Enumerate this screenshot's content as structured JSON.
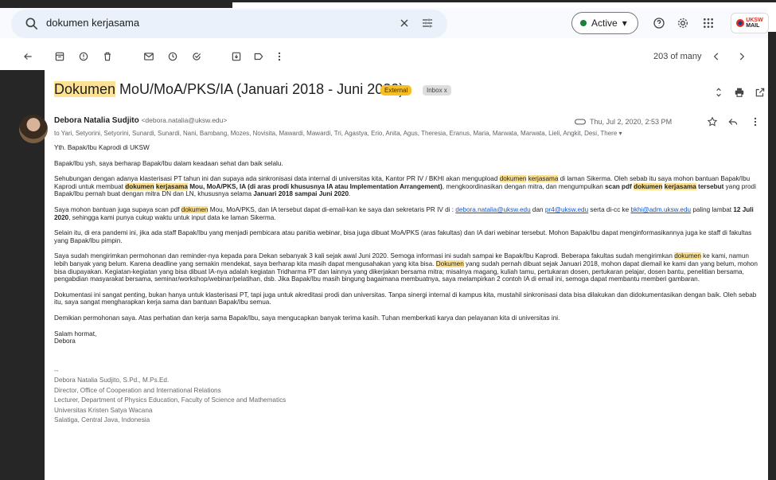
{
  "search": {
    "query": "dokumen kerjasama"
  },
  "status": {
    "label": "Active"
  },
  "logo": {
    "line1": "UKSW",
    "line2": "MAIL"
  },
  "toolbar": {
    "count": "203 of many"
  },
  "subject": {
    "highlight": "Dokumen",
    "rest": " MoU/MoA/PKS/IA (Januari 2018 - Juni 2020)",
    "tag_external": "External",
    "tag_inbox": "Inbox x"
  },
  "sender": {
    "name": "Debora Natalia Sudjito",
    "email": "<debora.natalia@uksw.edu>",
    "date": "Thu, Jul 2, 2020, 2:53 PM",
    "to": "to Yari, Setyorini, Setyorini, Sunardi, Sunardi, Nani, Bambang, Mozes, Novisita, Mawardi, Mawardi, Tri, Agastya, Erio, Anita, Agus, Theresia, Eranus, Maria, Marwata, Marwata, Lieli, Angkit, Desi, There ▾"
  },
  "body": {
    "greeting": "Yth. Bapak/Ibu Kaprodi di UKSW",
    "p1": "Bapak/Ibu ysh, saya berharap Bapak/Ibu dalam keadaan sehat dan baik selalu.",
    "p2": {
      "a": "Sehubungan dengan adanya klasterisasi PT tahun ini dan supaya ada sinkronisasi data internal di universitas kita, Kantor PR IV / BKHI akan mengupload ",
      "h1": "dokumen",
      "s1": " ",
      "h2": "kerjasama",
      "b": " di laman Sikerma. Oleh sebab itu saya mohon bantuan Bapak/Ibu Kaprodi untuk membuat ",
      "h3": "dokumen",
      "s2": " ",
      "h4": "kerjasama",
      "bold1": " Mou, MoA/PKS, IA (di aras prodi khususnya IA atau Implementation Arrangement)",
      "c": ", mengkoordinasikan dengan mitra, dan mengumpulkan ",
      "bold2": "scan pdf ",
      "h5": "dokumen",
      "s3": " ",
      "h6": "kerjasama",
      "bold3": " tersebut",
      "d": " yang prodi Bapak/Ibu pernah buat dengan mitra DN dan LN, khususnya selama ",
      "bold4": "Januari 2018 sampai Juni 2020",
      "e": "."
    },
    "p3": {
      "a": "Saya mohon bantuan juga supaya scan pdf ",
      "h1": "dokumen",
      "b": " Mou, MoA/PKS, dan IA  tersebut dapat di-email-kan ke saya dan sekretaris PR IV di : ",
      "link1": "debora.natalia@uksw.edu",
      "c": " dan ",
      "link2": "pr4@uksw.edu",
      "d": " serta di-cc ke ",
      "link3": "bkhi@adm.uksw.edu",
      "e": " paling lambat ",
      "bold1": "12 Juli 2020",
      "f": ", sehingga kami punya cukup waktu untuk input data ke laman Sikerma."
    },
    "p4": "Selain itu, di era pandemi ini, jika ada staff Bapak/Ibu yang menjadi pembicara atau panitia webinar, bisa juga dibuat MoA/PKS (aras fakultas) dan IA dari webinar tersebut. Mohon Bapak/Ibu dapat menginformasikannya juga ke staff di fakultas yang Bapak/Ibu pimpin.",
    "p5": {
      "a": "Saya sudah mengirimkan permohonan dan reminder-nya kepada para Dekan sebanyak 3 kali sejak awal Juni 2020. Semoga informasi ini sudah sampai ke Bapak/Ibu Kaprodi. Beberapa fakultas sudah mengirimkan ",
      "h1": "dokumen",
      "b": " ke kami, namun lebih banyak yang belum. Karena deadline yang semakin mendekat, saya berharap kita masih dapat mengusahakan yang kita bisa. ",
      "h2": "Dokumen",
      "c": " yang sudah pernah dibuat sejak Januari 2018, mohon dapat diemail ke kami dan yang belum, mohon bisa diupayakan. Kegiatan-kegiatan yang bisa dibuat IA-nya adalah kegiatan Tridharma PT dan lainnya yang dikerjakan bersama mitra; misalnya magang, kuliah tamu, pertukaran dosen, pertukaran pelajar, dosen bantu, penelitian bersama, pengabdian masyarakat bersama, seminar/workshop/webinar/pelatihan, dsb. Jika Bapak/Ibu masih bingung bagaimana membuatnya, saya melampirkan 2 contoh IA di email ini, semoga dapat membantu memberi gambaran."
    },
    "p6": "Dokumentasi ini sangat penting, bukan hanya untuk klasterisasi PT, tapi juga untuk akreditasi prodi dan universitas. Tanpa sinergi internal di kampus kita, mustahil sinkronisasi data bisa dilakukan dan didokumentasikan dengan baik. Oleh sebab itu, saya sangat mengharapkan kerja sama dan bantuan Bapak/Ibu semua.",
    "p7": "Demikian permohonan saya. Atas perhatian dan kerja sama Bapak/Ibu, saya mengucapkan banyak terima kasih. Tuhan memberkati karya dan pelayanan kita di universitas ini.",
    "closing1": "Salam hormat,",
    "closing2": "Debora"
  },
  "signature": {
    "dash": "--",
    "line1": "Debora Natalia Sudjito, S.Pd., M.Ps.Ed.",
    "line2": "Director, Office of Cooperation and International Relations",
    "line3": "Lecturer, Department of Physics Education, Faculty of Science and Mathematics",
    "line4": "Universitas Kristen Satya Wacana",
    "line5": "Salatiga, Central Java, Indonesia"
  }
}
